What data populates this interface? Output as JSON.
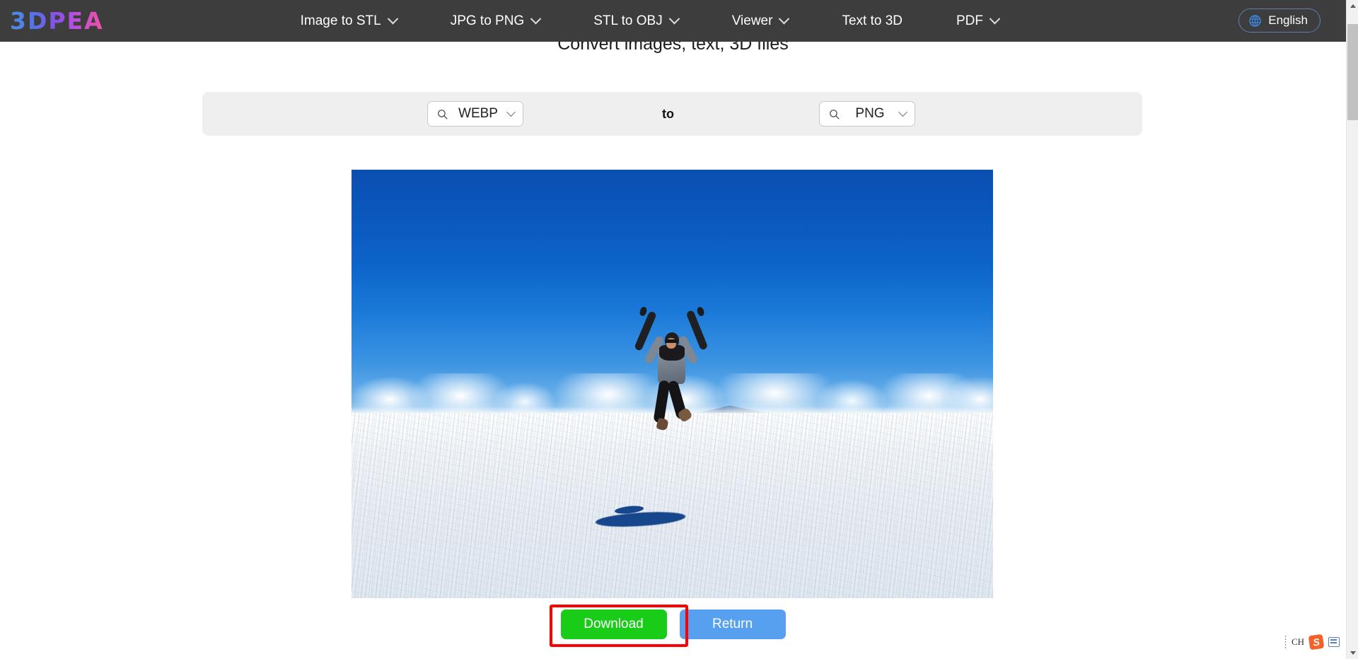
{
  "navbar": {
    "logo_text": "3DPEA",
    "items": [
      {
        "label": "Image to STL",
        "has_dropdown": true
      },
      {
        "label": "JPG to PNG",
        "has_dropdown": true
      },
      {
        "label": "STL to OBJ",
        "has_dropdown": true
      },
      {
        "label": "Viewer",
        "has_dropdown": true
      },
      {
        "label": "Text to 3D",
        "has_dropdown": false
      },
      {
        "label": "PDF",
        "has_dropdown": true
      }
    ],
    "language": {
      "label": "English",
      "icon": "globe-icon"
    },
    "background_color": "#3d3d3d"
  },
  "heading": {
    "title": "Convert images, text, 3D files"
  },
  "converter": {
    "source_format": "WEBP",
    "target_format": "PNG",
    "connector_word": "to",
    "search_icon": "search-icon",
    "dropdown_icon": "chevron-down-icon",
    "bar_color": "#efefef"
  },
  "preview": {
    "alt": "Person jumping on a white salt flat under a deep blue sky",
    "sky_color_top": "#0b4fb0",
    "sky_color_horizon": "#a9d2f2",
    "ground_color": "#f2f5f8",
    "shadow_color": "#16468c"
  },
  "actions": {
    "download_label": "Download",
    "download_color": "#18cc18",
    "return_label": "Return",
    "return_color": "#57a0f0",
    "highlight_color": "#ff0000"
  },
  "scrollbar": {
    "up_arrow": "triangle-up-icon",
    "down_arrow": "triangle-down-icon"
  },
  "ime": {
    "language_code": "CH",
    "logo_letter": "S",
    "keyboard_icon": "keyboard-icon"
  }
}
